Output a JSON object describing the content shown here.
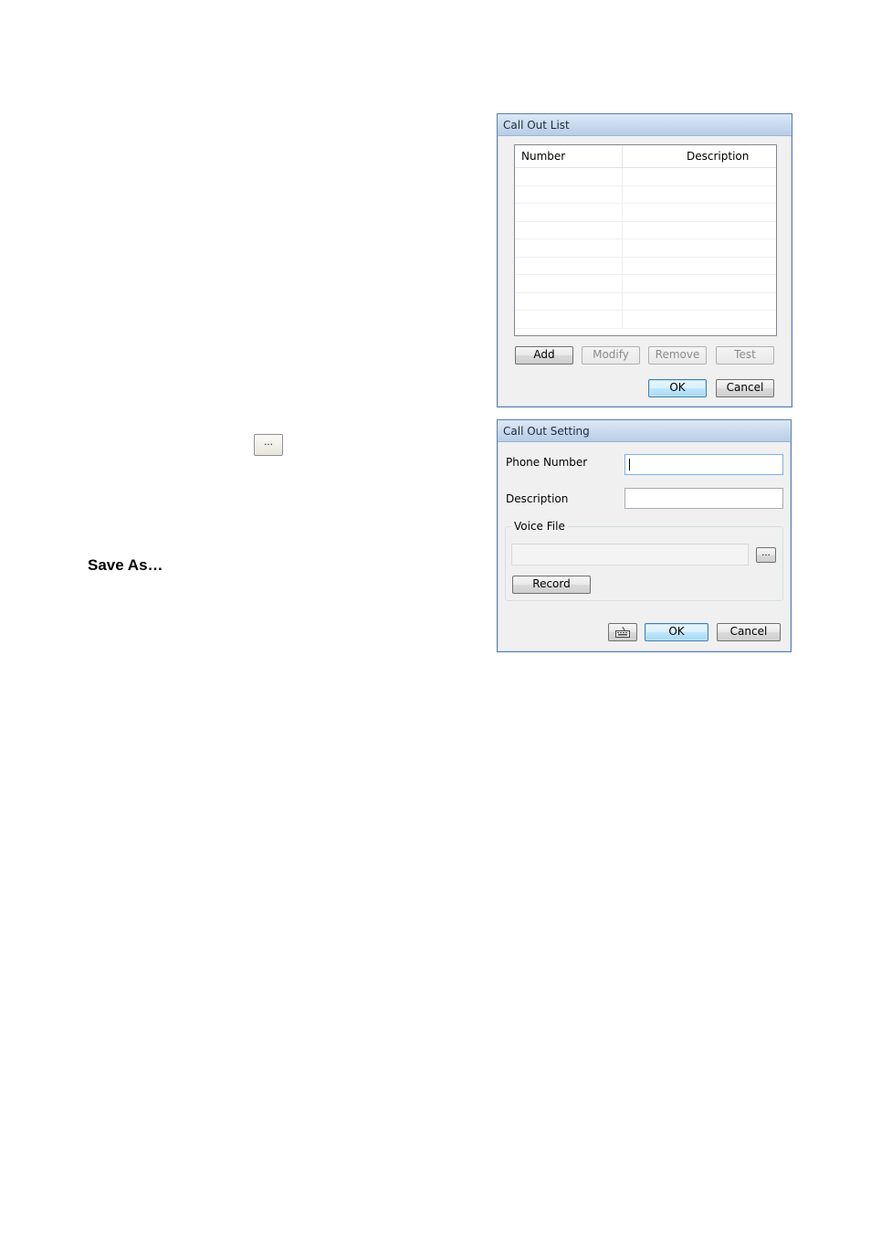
{
  "page": {
    "browse_button_label": "...",
    "save_as_heading": "Save As…"
  },
  "call_out_list": {
    "title": "Call Out List",
    "columns": [
      "Number",
      "Description"
    ],
    "rows": [],
    "buttons": {
      "add": "Add",
      "modify": "Modify",
      "remove": "Remove",
      "test": "Test",
      "ok": "OK",
      "cancel": "Cancel"
    }
  },
  "call_out_setting": {
    "title": "Call Out Setting",
    "phone_number_label": "Phone Number",
    "phone_number_value": "",
    "description_label": "Description",
    "description_value": "",
    "voice_file_group": "Voice File",
    "voice_file_value": "",
    "browse_label": "...",
    "record_label": "Record",
    "keyboard_icon": "keyboard-icon",
    "ok_label": "OK",
    "cancel_label": "Cancel"
  }
}
